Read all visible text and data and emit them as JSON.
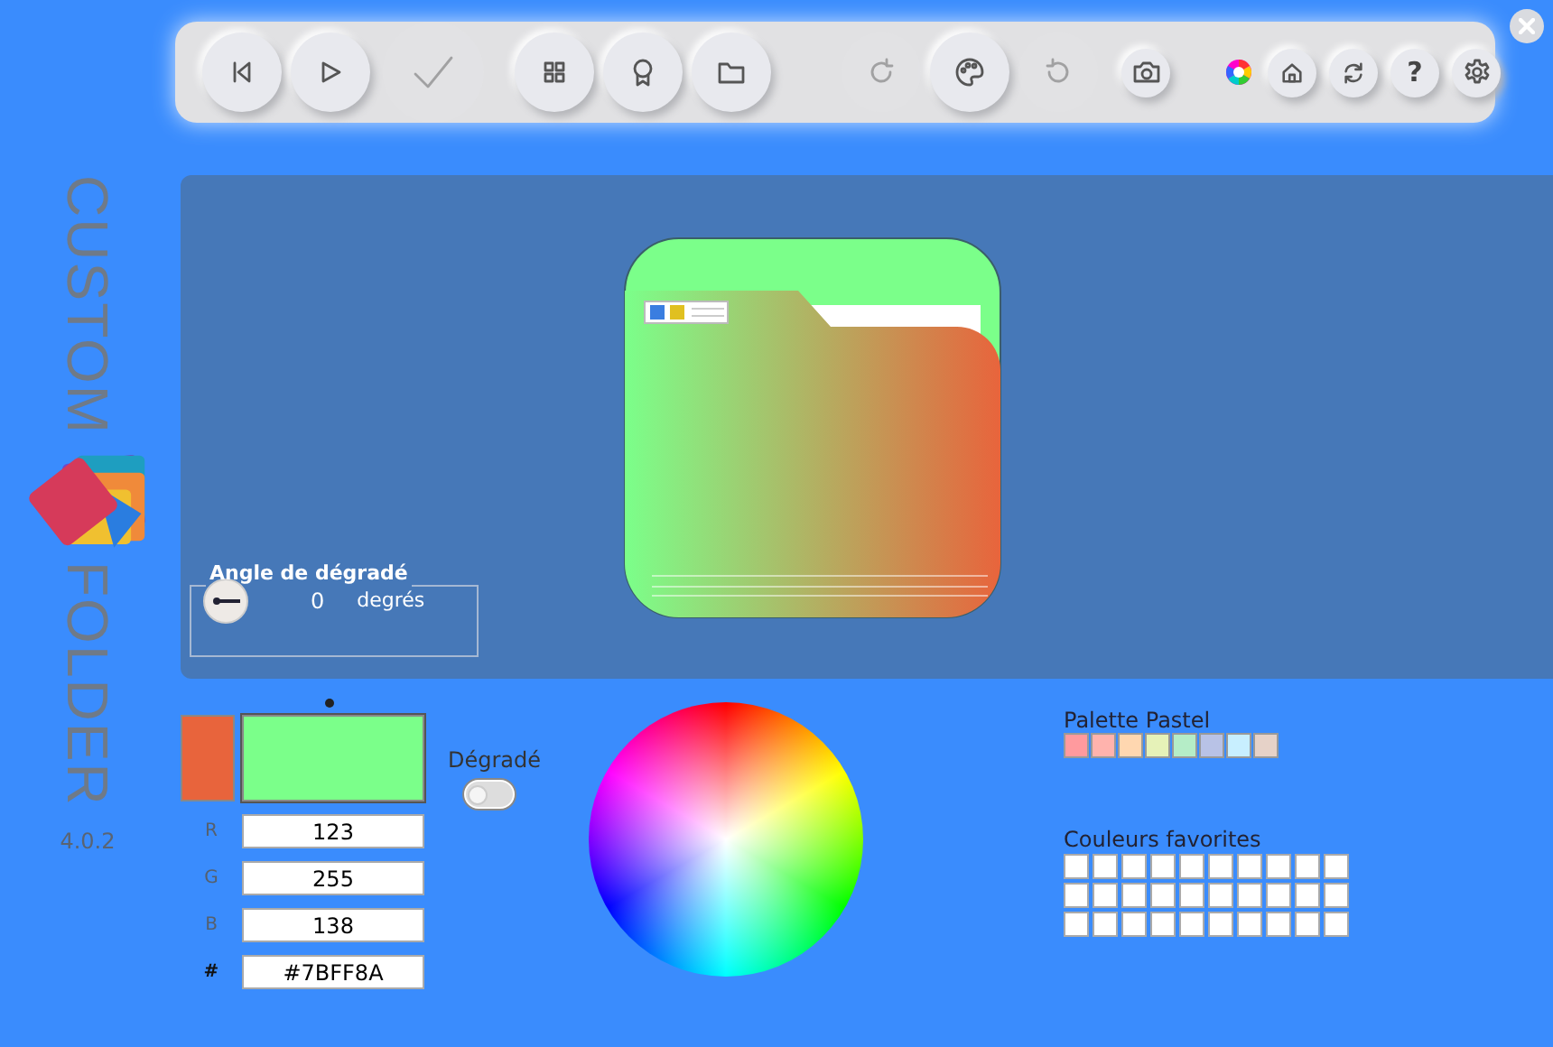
{
  "sidebar": {
    "title_parts": [
      "CUSTOM",
      "FOLDER"
    ],
    "version": "4.0.2"
  },
  "toolbar": [
    {
      "kind": "large",
      "disabled": false
    },
    {
      "kind": "large",
      "disabled": false
    },
    {
      "kind": "huge",
      "disabled": true
    },
    {
      "kind": "large",
      "disabled": false
    },
    {
      "kind": "large",
      "disabled": false
    },
    {
      "kind": "large",
      "disabled": false
    },
    {
      "kind": "large",
      "disabled": true
    },
    {
      "kind": "large",
      "disabled": false
    },
    {
      "kind": "large",
      "disabled": true
    },
    {
      "kind": "small",
      "disabled": false
    },
    {
      "kind": "tiny",
      "disabled": false
    },
    {
      "kind": "small",
      "disabled": false
    },
    {
      "kind": "small",
      "disabled": false
    },
    {
      "kind": "small",
      "disabled": false,
      "label": "?"
    },
    {
      "kind": "small",
      "disabled": false
    }
  ],
  "angle": {
    "legend": "Angle de dégradé",
    "value": "0",
    "unit": "degrés"
  },
  "swatches": [
    {
      "color": "#e8643c",
      "selected": false
    },
    {
      "color": "#7bff8a",
      "selected": true
    }
  ],
  "rgb_fields": [
    {
      "label": "R",
      "value": "123"
    },
    {
      "label": "G",
      "value": "255"
    },
    {
      "label": "B",
      "value": "138"
    },
    {
      "label": "#",
      "value": "#7BFF8A"
    }
  ],
  "gradient_toggle": {
    "label": "Dégradé",
    "on": false
  },
  "pastel_palette": {
    "title": "Palette Pastel",
    "colors": [
      {
        "color": "#ff9a9e"
      },
      {
        "color": "#ffb3ad"
      },
      {
        "color": "#ffd7b0"
      },
      {
        "color": "#e6f2b8"
      },
      {
        "color": "#b5edc7"
      },
      {
        "color": "#b8c2e6"
      },
      {
        "color": "#c8efff"
      },
      {
        "color": "#e6d2c8"
      }
    ]
  },
  "favorites": {
    "title": "Couleurs favorites",
    "colors": [
      {
        "color": "#ffffff"
      },
      {
        "color": "#ffffff"
      },
      {
        "color": "#ffffff"
      },
      {
        "color": "#ffffff"
      },
      {
        "color": "#ffffff"
      },
      {
        "color": "#ffffff"
      },
      {
        "color": "#ffffff"
      },
      {
        "color": "#ffffff"
      },
      {
        "color": "#ffffff"
      },
      {
        "color": "#ffffff"
      },
      {
        "color": "#ffffff"
      },
      {
        "color": "#ffffff"
      },
      {
        "color": "#ffffff"
      },
      {
        "color": "#ffffff"
      },
      {
        "color": "#ffffff"
      },
      {
        "color": "#ffffff"
      },
      {
        "color": "#ffffff"
      },
      {
        "color": "#ffffff"
      },
      {
        "color": "#ffffff"
      },
      {
        "color": "#ffffff"
      },
      {
        "color": "#ffffff"
      },
      {
        "color": "#ffffff"
      },
      {
        "color": "#ffffff"
      },
      {
        "color": "#ffffff"
      },
      {
        "color": "#ffffff"
      },
      {
        "color": "#ffffff"
      },
      {
        "color": "#ffffff"
      },
      {
        "color": "#ffffff"
      },
      {
        "color": "#ffffff"
      },
      {
        "color": "#ffffff"
      }
    ]
  }
}
